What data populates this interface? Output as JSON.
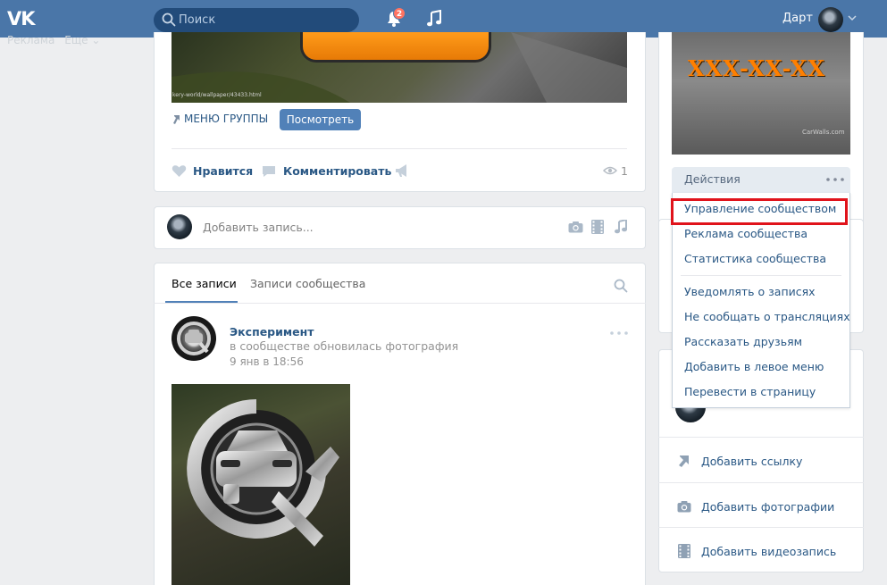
{
  "header": {
    "logo": "VK",
    "search_placeholder": "Поиск",
    "notification_count": "2",
    "user_name": "Дарт"
  },
  "left_links": [
    "Реклама",
    "Еще ⌄"
  ],
  "post_top": {
    "image_caption": "kery-world/wallpaper/43433.html",
    "menu_group_label": "МЕНЮ ГРУППЫ",
    "view_button": "Посмотреть",
    "like_label": "Нравится",
    "comment_label": "Комментировать",
    "views": "1"
  },
  "composer": {
    "placeholder": "Добавить запись..."
  },
  "feed": {
    "tabs": [
      "Все записи",
      "Записи сообщества"
    ],
    "post": {
      "author": "Эксперимент",
      "subtitle": "в сообществе обновилась фотография",
      "date": "9 янв в 18:56"
    }
  },
  "right": {
    "cover_text": "XXX-XX-XX",
    "cover_watermark": "CarWalls.com",
    "actions_label": "Действия",
    "menu": [
      "Управление сообществом",
      "Реклама сообщества",
      "Статистика сообщества",
      "Уведомлять о записях",
      "Не сообщать о трансляциях",
      "Рассказать друзьям",
      "Добавить в левое меню",
      "Перевести в страницу"
    ],
    "bottom_items": [
      "Добавить ссылку",
      "Добавить фотографии",
      "Добавить видеозапись"
    ]
  },
  "colors": {
    "header_bg": "#4a76a8",
    "link": "#2a5885",
    "button": "#5181b8",
    "highlight": "#e0131b",
    "badge": "#ff7361"
  }
}
